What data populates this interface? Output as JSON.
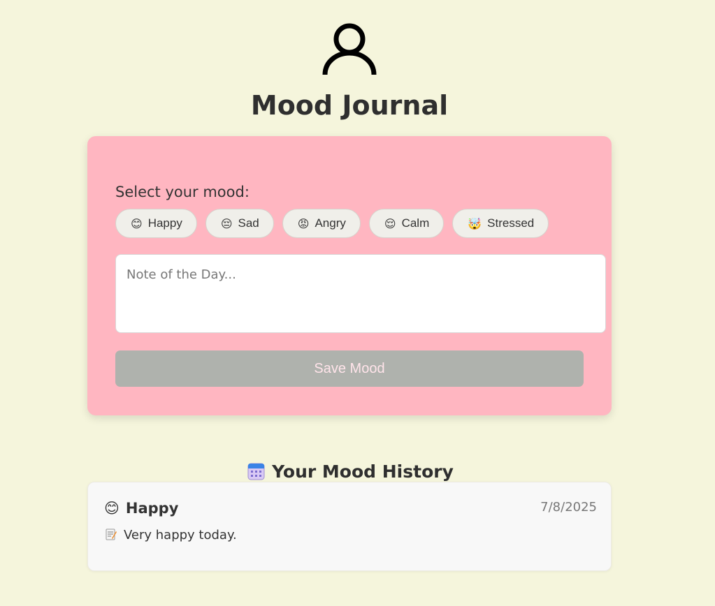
{
  "header": {
    "avatar_icon": "user-icon",
    "title": "Mood Journal"
  },
  "form": {
    "label": "Select your mood:",
    "moods": [
      {
        "emoji": "😊",
        "label": "Happy"
      },
      {
        "emoji": "😔",
        "label": "Sad"
      },
      {
        "emoji": "😡",
        "label": "Angry"
      },
      {
        "emoji": "😌",
        "label": "Calm"
      },
      {
        "emoji": "🤯",
        "label": "Stressed"
      }
    ],
    "note": {
      "value": "",
      "placeholder": "Note of the Day..."
    },
    "save_label": "Save Mood",
    "save_enabled": false
  },
  "history": {
    "icon": "calendar-icon",
    "title": "Your Mood History",
    "entries": [
      {
        "emoji": "😊",
        "mood": "Happy",
        "date": "7/8/2025",
        "note_icon": "memo-icon",
        "note": "Very happy today."
      }
    ]
  },
  "colors": {
    "background": "#f5f5dc",
    "card": "#ffb6c1",
    "button_disabled": "#afb2ad",
    "entry_background": "#f8f8f8"
  }
}
